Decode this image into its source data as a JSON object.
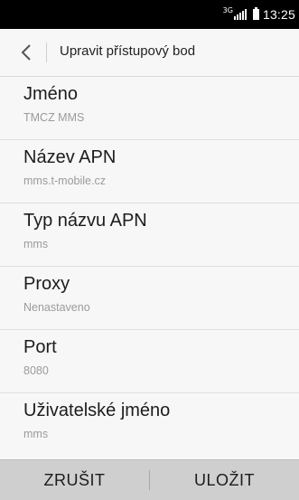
{
  "status_bar": {
    "network_type": "3G",
    "signal_icon": "signal-bars-icon",
    "battery_icon": "battery-icon",
    "time": "13:25"
  },
  "header": {
    "back_icon": "chevron-left-icon",
    "title": "Upravit přístupový bod"
  },
  "fields": [
    {
      "label": "Jméno",
      "value": "TMCZ MMS"
    },
    {
      "label": "Název APN",
      "value": "mms.t-mobile.cz"
    },
    {
      "label": "Typ názvu APN",
      "value": "mms"
    },
    {
      "label": "Proxy",
      "value": "Nenastaveno"
    },
    {
      "label": "Port",
      "value": "8080"
    },
    {
      "label": "Uživatelské jméno",
      "value": "mms"
    }
  ],
  "bottom_bar": {
    "cancel_label": "ZRUŠIT",
    "save_label": "ULOŽIT"
  },
  "colors": {
    "background": "#f7f7f7",
    "status_bar": "#000000",
    "bottom_bar": "#cfcfcf",
    "value_text": "#9b9b9b"
  }
}
